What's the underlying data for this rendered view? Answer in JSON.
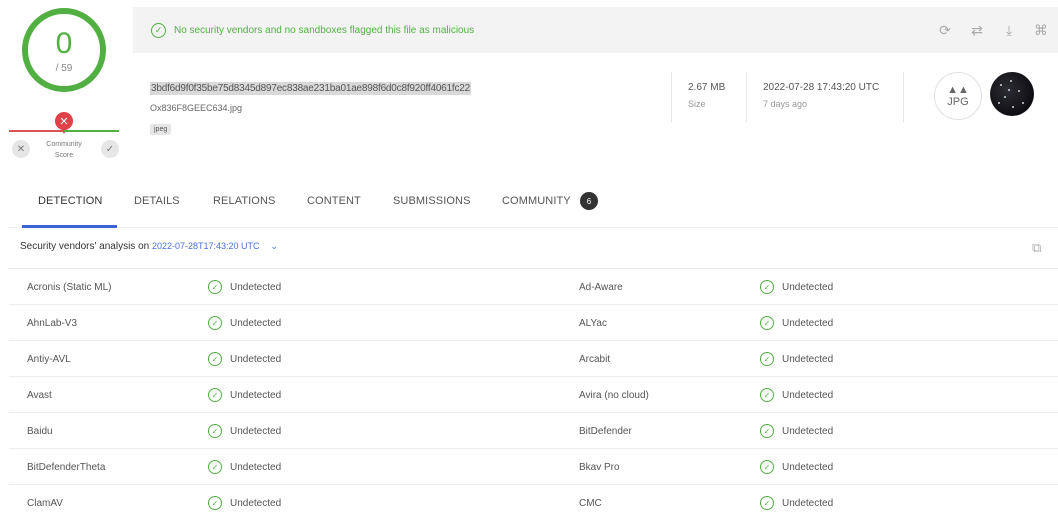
{
  "score": {
    "detections": "0",
    "total": "/ 59"
  },
  "community": {
    "label": "Community Score",
    "down_icon": "x-icon",
    "up_icon": "check-icon",
    "marker_icon": "x-icon"
  },
  "banner": {
    "text": "No security vendors and no sandboxes flagged this file as malicious",
    "color": "#52b043"
  },
  "toolbar": {
    "icons": [
      "reanalyze-icon",
      "compare-icon",
      "download-icon",
      "graph-icon"
    ]
  },
  "file": {
    "hash": "3bdf6d9f0f35be75d8345d897ec838ae231ba01ae898f6d0c8f920ff4061fc22",
    "name": "Ox836F8GEEC634.jpg",
    "tag": "jpeg",
    "size_value": "2.67 MB",
    "size_label": "Size",
    "date_value": "2022-07-28 17:43:20 UTC",
    "date_ago": "7 days ago",
    "type_label": "JPG"
  },
  "tabs": [
    {
      "label": "DETECTION"
    },
    {
      "label": "DETAILS"
    },
    {
      "label": "RELATIONS"
    },
    {
      "label": "CONTENT"
    },
    {
      "label": "SUBMISSIONS"
    },
    {
      "label": "COMMUNITY"
    }
  ],
  "community_count": "6",
  "analysis": {
    "label": "Security vendors' analysis on",
    "date": "2022-07-28T17:43:20 UTC",
    "caret": "⌄"
  },
  "vendors": [
    {
      "left_name": "Acronis (Static ML)",
      "left_result": "Undetected",
      "right_name": "Ad-Aware",
      "right_result": "Undetected"
    },
    {
      "left_name": "AhnLab-V3",
      "left_result": "Undetected",
      "right_name": "ALYac",
      "right_result": "Undetected"
    },
    {
      "left_name": "Antiy-AVL",
      "left_result": "Undetected",
      "right_name": "Arcabit",
      "right_result": "Undetected"
    },
    {
      "left_name": "Avast",
      "left_result": "Undetected",
      "right_name": "Avira (no cloud)",
      "right_result": "Undetected"
    },
    {
      "left_name": "Baidu",
      "left_result": "Undetected",
      "right_name": "BitDefender",
      "right_result": "Undetected"
    },
    {
      "left_name": "BitDefenderTheta",
      "left_result": "Undetected",
      "right_name": "Bkav Pro",
      "right_result": "Undetected"
    },
    {
      "left_name": "ClamAV",
      "left_result": "Undetected",
      "right_name": "CMC",
      "right_result": "Undetected"
    }
  ],
  "colors": {
    "accent": "#3b62d6",
    "clean": "#52b043",
    "malicious": "#e0424a"
  }
}
